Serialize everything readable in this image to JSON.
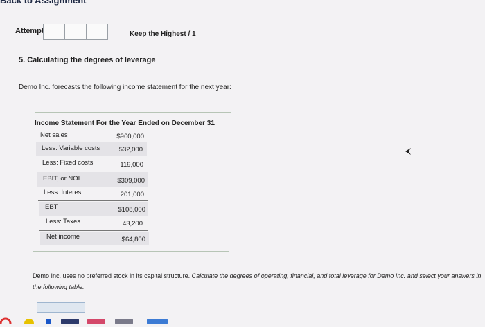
{
  "nav": {
    "back_label": "Back to Assignment"
  },
  "attempts": {
    "label": "Attempts",
    "keep_label": "Keep the Highest / 1"
  },
  "question": {
    "title": "5. Calculating the degrees of leverage",
    "intro": "Demo Inc. forecasts the following income statement for the next year:"
  },
  "income_statement": {
    "title": "Income Statement For the Year Ended on December 31",
    "rows": [
      {
        "label": "Net sales",
        "value": "$960,000"
      },
      {
        "label": "Less: Variable costs",
        "value": "532,000"
      },
      {
        "label": "Less: Fixed costs",
        "value": "119,000"
      },
      {
        "label": "EBIT, or NOI",
        "value": "$309,000"
      },
      {
        "label": "Less: Interest",
        "value": "201,000"
      },
      {
        "label": "EBT",
        "value": "$108,000"
      },
      {
        "label": "Less: Taxes",
        "value": "43,200"
      },
      {
        "label": "Net income",
        "value": "$64,800"
      }
    ]
  },
  "footnote": {
    "part1": "Demo Inc. uses no preferred stock in its capital structure.",
    "part2": "Calculate the degrees of operating, financial, and total leverage for Demo Inc. and select your answers in the following table."
  },
  "colors": {
    "shade": "#e4e3e7",
    "rule": "#b7c5b6",
    "background": "#f3f2f4"
  }
}
